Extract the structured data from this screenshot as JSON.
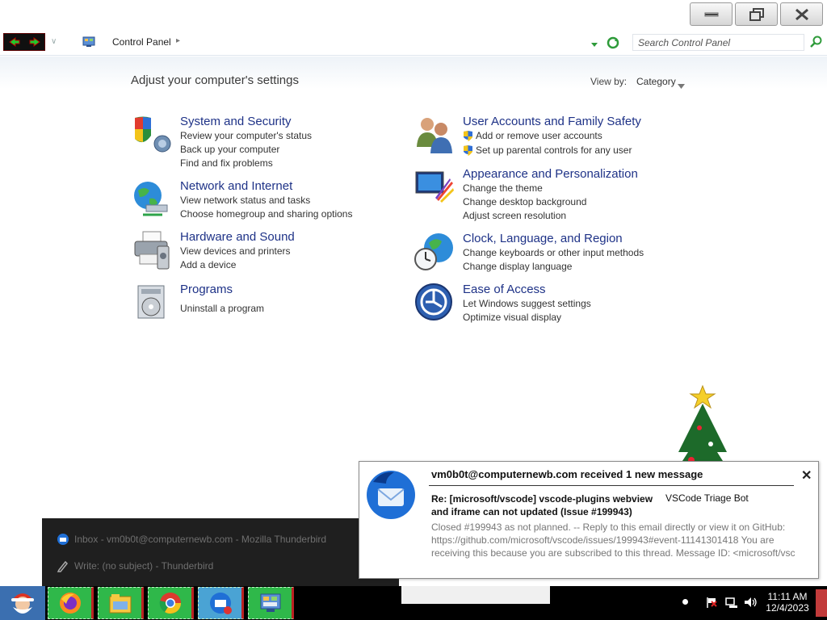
{
  "window": {
    "minimize_icon": "minimize-icon",
    "restore_icon": "restore-icon",
    "close_icon": "close-icon"
  },
  "address": {
    "breadcrumb": "Control Panel",
    "search_placeholder": "Search Control Panel"
  },
  "main": {
    "title": "Adjust your computer's settings",
    "view_by_label": "View by:",
    "view_by_value": "Category",
    "categories": [
      {
        "title": "System and Security",
        "icon": "shield-icon",
        "links": [
          "Review your computer's status",
          "Back up your computer",
          "Find and fix problems"
        ]
      },
      {
        "title": "Network and Internet",
        "icon": "globe-network-icon",
        "links": [
          "View network status and tasks",
          "Choose homegroup and sharing options"
        ]
      },
      {
        "title": "Hardware and Sound",
        "icon": "printer-icon",
        "links": [
          "View devices and printers",
          "Add a device"
        ]
      },
      {
        "title": "Programs",
        "icon": "programs-icon",
        "links": [
          "Uninstall a program"
        ]
      },
      {
        "title": "User Accounts and Family Safety",
        "icon": "users-icon",
        "links": [
          "Add or remove user accounts",
          "Set up parental controls for any user"
        ]
      },
      {
        "title": "Appearance and Personalization",
        "icon": "monitor-paint-icon",
        "links": [
          "Change the theme",
          "Change desktop background",
          "Adjust screen resolution"
        ]
      },
      {
        "title": "Clock, Language, and Region",
        "icon": "clock-globe-icon",
        "links": [
          "Change keyboards or other input methods",
          "Change display language"
        ]
      },
      {
        "title": "Ease of Access",
        "icon": "ease-of-access-icon",
        "links": [
          "Let Windows suggest settings",
          "Optimize visual display"
        ]
      }
    ]
  },
  "jump_list": {
    "items": [
      {
        "label": "Inbox - vm0b0t@computernewb.com - Mozilla Thunderbird",
        "icon": "thunderbird-icon"
      },
      {
        "label": "Write: (no subject) - Thunderbird",
        "icon": "pencil-icon"
      }
    ]
  },
  "notification": {
    "heading": "vm0b0t@computernewb.com received 1 new message",
    "subject": "Re: [microsoft/vscode] vscode-plugins webview and iframe can not updated (Issue #199943)",
    "from": "VSCode Triage Bot",
    "body": "Closed #199943 as not planned. -- Reply to this email directly or view it on GitHub: https://github.com/microsoft/vscode/issues/199943#event-11141301418 You are receiving this because you are subscribed to this thread. Message ID: <microsoft/vsc",
    "close_symbol": "✕"
  },
  "taskbar": {
    "apps": [
      "firefox-icon",
      "file-explorer-icon",
      "chrome-icon",
      "thunderbird-icon",
      "control-panel-icon"
    ],
    "time": "11:11 AM",
    "date": "12/4/2023"
  },
  "colors": {
    "link_title": "#1e3287",
    "taskbar_app_green": "#2fb84a"
  }
}
